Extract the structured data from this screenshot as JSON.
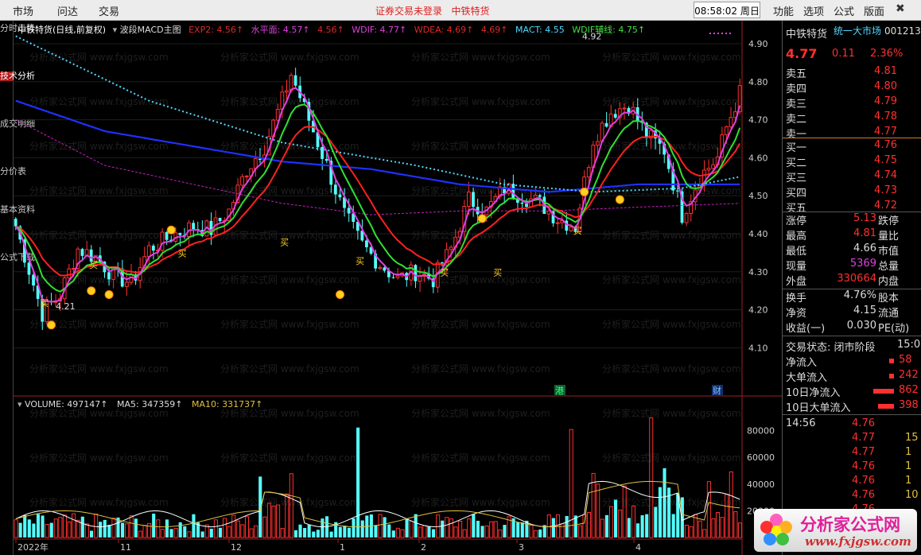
{
  "menu": {
    "market": "市场",
    "ask": "问达",
    "trade": "交易",
    "notice": "证券交易未登录",
    "notice_stock": "中铁特货",
    "clock": "08:58:02 周日",
    "function": "功能",
    "options": "选项",
    "formula": "公式",
    "layout": "版面"
  },
  "left_tabs": [
    "分时走势",
    "技术分析",
    "成交明细",
    "分价表",
    "基本资料",
    "公式下载"
  ],
  "indicator_bar": {
    "title": "中铁特货(日线,前复权)",
    "formula": "波段MACD主图",
    "exp2": "EXP2: 4.56↑",
    "level": "水平面: 4.57↑",
    "dup": "4.56↑",
    "wdif": "WDIF: 4.77↑",
    "wdea": "WDEA: 4.69↑",
    "dup2": "4.69↑",
    "mact": "MACT: 4.55",
    "wdif_aux": "WDIF辅线: 4.75↑"
  },
  "volume_bar": {
    "vol": "VOLUME: 497147↑",
    "ma5": "MA5: 347359↑",
    "ma10": "MA10: 331737↑"
  },
  "annotations": {
    "high": "4.92",
    "low": "4.21",
    "buy": "买",
    "gang": "港",
    "cai": "财"
  },
  "price_axis": [
    "4.90",
    "4.80",
    "4.70",
    "4.60",
    "4.50",
    "4.40",
    "4.30",
    "4.20",
    "4.10"
  ],
  "volume_axis": [
    "80000",
    "60000",
    "40000",
    "20000"
  ],
  "x_axis": [
    "2022年",
    "11",
    "12",
    "1",
    "2",
    "3",
    "4"
  ],
  "quote": {
    "name": "中铁特货",
    "market": "统一大市场",
    "code": "001213",
    "price": "4.77",
    "change": "0.11",
    "pct": "2.36%",
    "asks": [
      {
        "label": "卖五",
        "price": "4.81"
      },
      {
        "label": "卖四",
        "price": "4.80"
      },
      {
        "label": "卖三",
        "price": "4.79"
      },
      {
        "label": "卖二",
        "price": "4.78"
      },
      {
        "label": "卖一",
        "price": "4.77"
      }
    ],
    "bids": [
      {
        "label": "买一",
        "price": "4.76"
      },
      {
        "label": "买二",
        "price": "4.75"
      },
      {
        "label": "买三",
        "price": "4.74"
      },
      {
        "label": "买四",
        "price": "4.73"
      },
      {
        "label": "买五",
        "price": "4.72"
      }
    ],
    "stats": [
      {
        "l": "涨停",
        "v": "5.13",
        "r": "跌停"
      },
      {
        "l": "最高",
        "v": "4.81",
        "r": "量比"
      },
      {
        "l": "最低",
        "v": "4.66",
        "r": "市值"
      },
      {
        "l": "现量",
        "v": "5369",
        "r": "总量"
      },
      {
        "l": "外盘",
        "v": "330664",
        "r": "内盘"
      }
    ],
    "stats2": [
      {
        "l": "换手",
        "v": "4.76%",
        "r": "股本"
      },
      {
        "l": "净资",
        "v": "4.15",
        "r": "流通"
      },
      {
        "l": "收益(一)",
        "v": "0.030",
        "r": "PE(动)"
      }
    ],
    "trade_state": "交易状态: 闭市阶段",
    "trade_time": "15:0",
    "flows": [
      {
        "l": "净流入",
        "v": "58"
      },
      {
        "l": "大单流入",
        "v": "242"
      },
      {
        "l": "10日净流入",
        "v": "862"
      },
      {
        "l": "10日大单流入",
        "v": "398"
      }
    ],
    "tick_time": "14:56",
    "ticks": [
      {
        "p": "4.76",
        "v": ""
      },
      {
        "p": "4.77",
        "v": "15"
      },
      {
        "p": "4.77",
        "v": "1"
      },
      {
        "p": "4.76",
        "v": "1"
      },
      {
        "p": "4.76",
        "v": "1"
      },
      {
        "p": "4.76",
        "v": "10"
      },
      {
        "p": "4.76",
        "v": ""
      }
    ]
  },
  "watermark": "分析家公式网 www.fxjgsw.com",
  "logo": {
    "name": "分析家公式网",
    "url": "www.fxjgsw.com"
  }
}
